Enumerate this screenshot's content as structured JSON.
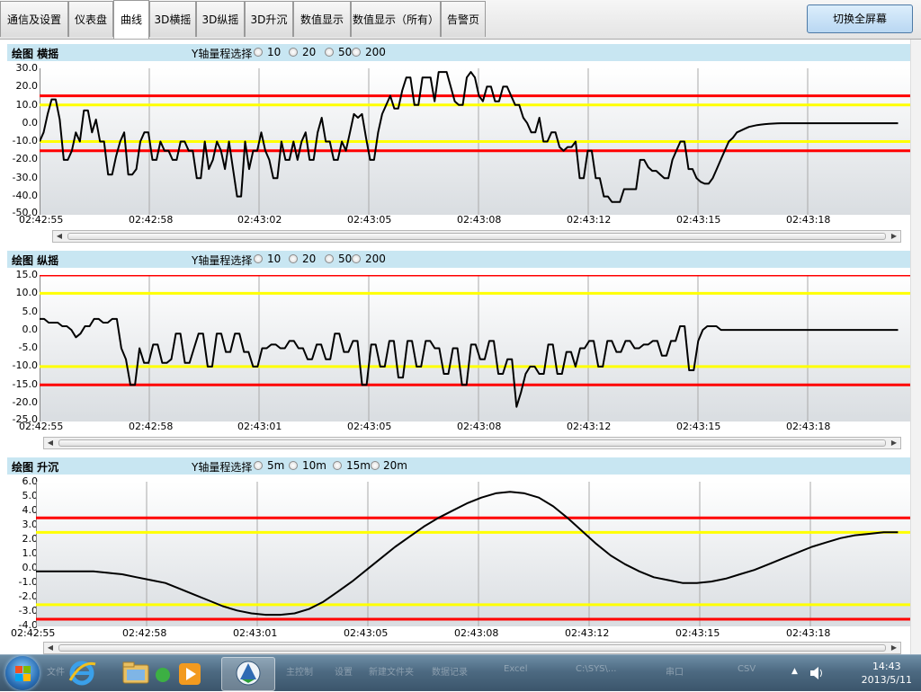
{
  "tabs": [
    {
      "label": "通信及设置",
      "active": false
    },
    {
      "label": "仪表盘",
      "active": false
    },
    {
      "label": "曲线",
      "active": true
    },
    {
      "label": "3D横摇",
      "active": false
    },
    {
      "label": "3D纵摇",
      "active": false
    },
    {
      "label": "3D升沉",
      "active": false
    },
    {
      "label": "数值显示",
      "active": false
    },
    {
      "label": "数值显示（所有）",
      "active": false
    },
    {
      "label": "告警页",
      "active": false
    }
  ],
  "fullscreen_button": "切换全屏幕",
  "colors": {
    "red_limit": "#ff0000",
    "yellow_limit": "#ffff00",
    "series": "#000000",
    "title_bg": "#c8e6f2"
  },
  "panels": [
    {
      "title": "绘图 横摇",
      "y_range_label": "Y轴量程选择",
      "range_options": [
        "10",
        "20",
        "50",
        "200"
      ],
      "y_ticks": [
        "30.0",
        "20.0",
        "10.0",
        "0.0",
        "-10.0",
        "-20.0",
        "-30.0",
        "-40.0",
        "-50.0"
      ],
      "x_ticks": [
        "02:42:55",
        "02:42:58",
        "02:43:02",
        "02:43:05",
        "02:43:08",
        "02:43:12",
        "02:43:15",
        "02:43:18"
      ]
    },
    {
      "title": "绘图 纵摇",
      "y_range_label": "Y轴量程选择",
      "range_options": [
        "10",
        "20",
        "50",
        "200"
      ],
      "y_ticks": [
        "15.0",
        "10.0",
        "5.0",
        "0.0",
        "-5.0",
        "-10.0",
        "-15.0",
        "-20.0",
        "-25.0"
      ],
      "x_ticks": [
        "02:42:55",
        "02:42:58",
        "02:43:01",
        "02:43:05",
        "02:43:08",
        "02:43:12",
        "02:43:15",
        "02:43:18"
      ]
    },
    {
      "title": "绘图 升沉",
      "y_range_label": "Y轴量程选择",
      "range_options": [
        "5m",
        "10m",
        "15m",
        "20m"
      ],
      "y_ticks": [
        "6.0",
        "5.0",
        "4.0",
        "3.0",
        "2.0",
        "1.0",
        "0.0",
        "-1.0",
        "-2.0",
        "-3.0",
        "-4.0"
      ],
      "x_ticks": [
        "02:42:55",
        "02:42:58",
        "02:43:01",
        "02:43:05",
        "02:43:08",
        "02:43:12",
        "02:43:15",
        "02:43:18"
      ]
    }
  ],
  "chart_data": [
    {
      "type": "line",
      "title": "绘图 横摇",
      "ylim": [
        -50,
        30
      ],
      "limits": {
        "red": [
          15,
          -15
        ],
        "yellow": [
          10,
          -10
        ]
      },
      "series": [
        {
          "values": [
            -10,
            -5,
            5,
            13,
            13,
            2,
            -20,
            -20,
            -15,
            -5,
            -10,
            7,
            7,
            -5,
            2,
            -10,
            -10,
            -28,
            -28,
            -18,
            -10,
            -5,
            -28,
            -28,
            -25,
            -10,
            -5,
            -5,
            -20,
            -20,
            -10,
            -15,
            -15,
            -20,
            -20,
            -10,
            -10,
            -15,
            -15,
            -30,
            -30,
            -10,
            -25,
            -20,
            -10,
            -15,
            -25,
            -10,
            -25,
            -40,
            -40,
            -10,
            -25,
            -15,
            -15,
            -5,
            -15,
            -20,
            -30,
            -30,
            -10,
            -20,
            -20,
            -10,
            -20,
            -10,
            -5,
            -20,
            -20,
            -5,
            3,
            -10,
            -10,
            -20,
            -20,
            -10,
            -15,
            -5,
            5,
            3,
            5,
            -8,
            -20,
            -20,
            -5,
            5,
            10,
            15,
            8,
            8,
            18,
            25,
            25,
            10,
            10,
            25,
            25,
            25,
            12,
            28,
            28,
            28,
            20,
            12,
            10,
            10,
            25,
            28,
            25,
            15,
            12,
            20,
            20,
            12,
            12,
            20,
            20,
            15,
            10,
            10,
            3,
            0,
            -5,
            -5,
            3,
            -10,
            -10,
            -5,
            -5,
            -13,
            -15,
            -13,
            -13,
            -10,
            -30,
            -30,
            -15,
            -15,
            -30,
            -30,
            -40,
            -40,
            -43,
            -43,
            -43,
            -36,
            -36,
            -36,
            -36,
            -20,
            -20,
            -24,
            -26,
            -26,
            -28,
            -30,
            -30,
            -20,
            -15,
            -10,
            -10,
            -25,
            -25,
            -30,
            -32,
            -33,
            -33,
            -30,
            -25,
            -20,
            -15,
            -10,
            -8,
            -5,
            -4,
            -3,
            -2,
            -1.5,
            -1,
            -0.7,
            -0.5,
            -0.3,
            -0.2,
            -0.1,
            0,
            0,
            0,
            0,
            0,
            0,
            0,
            0,
            0,
            0,
            0,
            0,
            0,
            0,
            0,
            0,
            0,
            0,
            0,
            0,
            0,
            0,
            0,
            0,
            0,
            0,
            0,
            0,
            0,
            0
          ]
        }
      ]
    },
    {
      "type": "line",
      "title": "绘图 纵摇",
      "ylim": [
        -25,
        15
      ],
      "limits": {
        "red": [
          15,
          -15
        ],
        "yellow": [
          10,
          -10
        ]
      },
      "series": [
        {
          "values": [
            3,
            3,
            2,
            2,
            2,
            1,
            1,
            0,
            -2,
            -1,
            1,
            1,
            3,
            3,
            2,
            2,
            3,
            3,
            -5,
            -8,
            -15,
            -15,
            -5,
            -9,
            -9,
            -4,
            -4,
            -9,
            -9,
            -8,
            -1,
            -1,
            -9,
            -9,
            -5,
            -1,
            -1,
            -10,
            -10,
            -1,
            -1,
            -6,
            -6,
            -1,
            -1,
            -6,
            -6,
            -10,
            -10,
            -5,
            -5,
            -4,
            -4,
            -5,
            -5,
            -3,
            -3,
            -5,
            -5,
            -8,
            -8,
            -4,
            -4,
            -8,
            -8,
            -1,
            -1,
            -6,
            -6,
            -3,
            -3,
            -15,
            -15,
            -4,
            -4,
            -10,
            -10,
            -3,
            -3,
            -13,
            -13,
            -3,
            -3,
            -10,
            -10,
            -3,
            -3,
            -5,
            -5,
            -12,
            -12,
            -5,
            -5,
            -15,
            -15,
            -4,
            -4,
            -8,
            -8,
            -3,
            -3,
            -12,
            -12,
            -8,
            -8,
            -21,
            -17,
            -12,
            -10,
            -10,
            -12,
            -12,
            -4,
            -4,
            -12,
            -12,
            -6,
            -6,
            -10,
            -5,
            -5,
            -3,
            -3,
            -10,
            -10,
            -3,
            -3,
            -6,
            -6,
            -3,
            -3,
            -5,
            -5,
            -4,
            -4,
            -3,
            -3,
            -7,
            -7,
            -3,
            -3,
            1,
            1,
            -11,
            -11,
            -3,
            0,
            1,
            1,
            1,
            0,
            0,
            0,
            0,
            0,
            0,
            0,
            0,
            0,
            0,
            0,
            0,
            0,
            0,
            0,
            0,
            0,
            0,
            0,
            0,
            0,
            0,
            0,
            0,
            0,
            0,
            0,
            0,
            0,
            0,
            0,
            0,
            0,
            0,
            0,
            0,
            0,
            0,
            0,
            0
          ]
        }
      ]
    },
    {
      "type": "line",
      "title": "绘图 升沉",
      "ylim": [
        -4,
        6
      ],
      "limits": {
        "red": [
          3.5,
          -3.5
        ],
        "yellow": [
          2.5,
          -2.5
        ]
      },
      "series": [
        {
          "values": [
            -0.2,
            -0.2,
            -0.2,
            -0.2,
            -0.2,
            -0.3,
            -0.4,
            -0.6,
            -0.8,
            -1.0,
            -1.4,
            -1.8,
            -2.2,
            -2.6,
            -2.9,
            -3.1,
            -3.2,
            -3.2,
            -3.1,
            -2.8,
            -2.3,
            -1.6,
            -0.9,
            -0.1,
            0.7,
            1.5,
            2.2,
            2.9,
            3.5,
            4.0,
            4.5,
            4.9,
            5.2,
            5.3,
            5.2,
            4.9,
            4.3,
            3.5,
            2.6,
            1.7,
            0.9,
            0.3,
            -0.2,
            -0.6,
            -0.8,
            -1.0,
            -1.0,
            -0.9,
            -0.7,
            -0.4,
            -0.1,
            0.3,
            0.7,
            1.1,
            1.5,
            1.8,
            2.1,
            2.3,
            2.4,
            2.5,
            2.5
          ]
        }
      ]
    }
  ],
  "taskbar": {
    "time": "14:43",
    "date": "2013/5/11",
    "ghost_labels": [
      "文件",
      "主控制",
      "设置",
      "新建文件夹",
      "数据记录",
      "Excel",
      "C:\\SYS\\...",
      "串口",
      "CSV"
    ]
  }
}
